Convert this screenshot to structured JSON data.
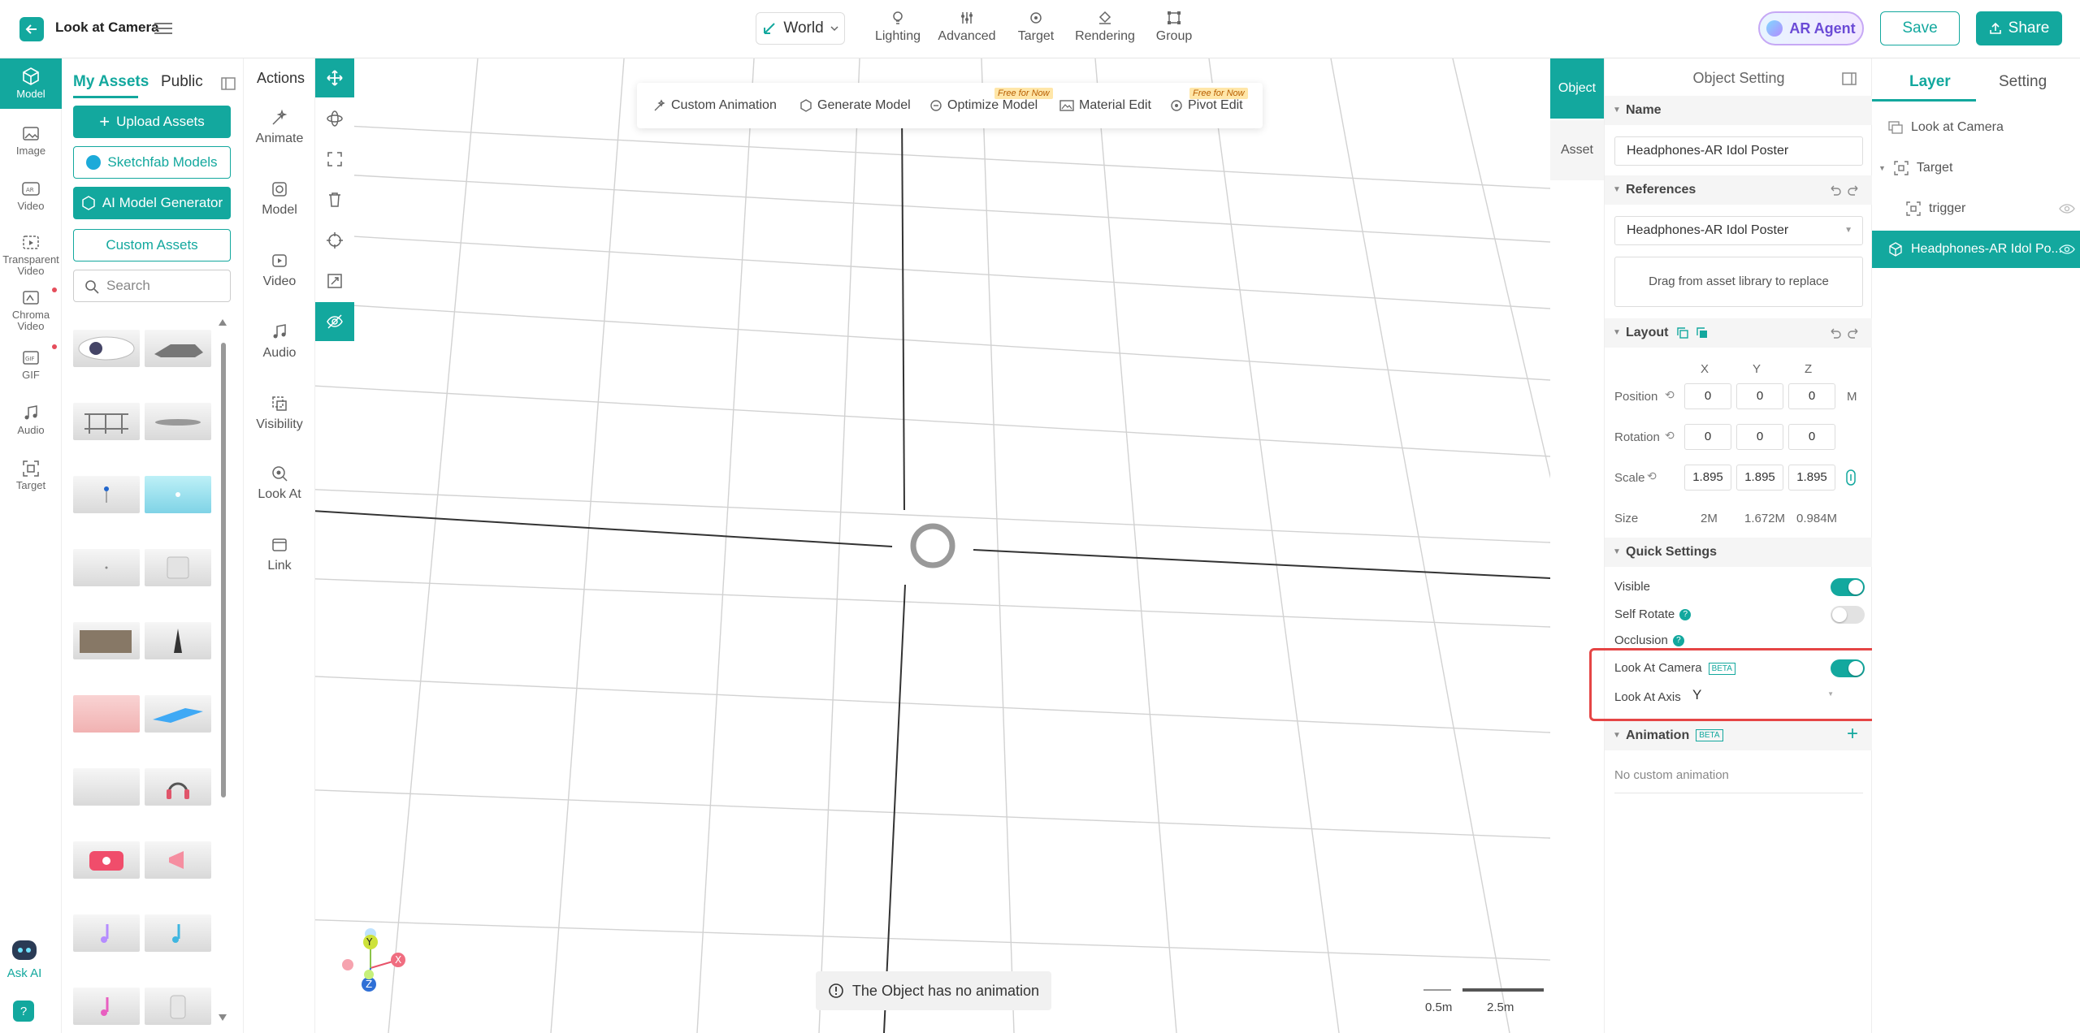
{
  "header": {
    "title": "Look at Camera",
    "world_label": "World",
    "tools": [
      {
        "label": "Lighting",
        "icon": "lightbulb-icon"
      },
      {
        "label": "Advanced",
        "icon": "sliders-icon"
      },
      {
        "label": "Target",
        "icon": "gear-target-icon"
      },
      {
        "label": "Rendering",
        "icon": "paint-bucket-icon"
      },
      {
        "label": "Group",
        "icon": "group-frame-icon"
      }
    ],
    "ar_agent_label": "AR Agent",
    "save_label": "Save",
    "share_label": "Share"
  },
  "rail": {
    "items": [
      {
        "label": "Model",
        "icon": "cube-icon"
      },
      {
        "label": "Image",
        "icon": "image-icon"
      },
      {
        "label": "Video",
        "icon": "ar-video-icon"
      },
      {
        "label": "Transparent Video",
        "icon": "transparent-video-icon"
      },
      {
        "label": "Chroma Video",
        "icon": "chroma-video-icon"
      },
      {
        "label": "GIF",
        "icon": "gif-icon"
      },
      {
        "label": "Audio",
        "icon": "music-note-icon"
      },
      {
        "label": "Target",
        "icon": "target-icon"
      }
    ],
    "ask_ai_label": "Ask AI"
  },
  "assets": {
    "tabs": [
      "My Assets",
      "Public"
    ],
    "upload_label": "Upload Assets",
    "sketchfab_label": "Sketchfab Models",
    "ai_generator_label": "AI Model Generator",
    "custom_label": "Custom Assets",
    "search_placeholder": "Search"
  },
  "actions": {
    "title": "Actions",
    "items": [
      {
        "label": "Animate",
        "icon": "wand-icon"
      },
      {
        "label": "Model",
        "icon": "model-icon"
      },
      {
        "label": "Video",
        "icon": "video-play-icon"
      },
      {
        "label": "Audio",
        "icon": "music-icon"
      },
      {
        "label": "Visibility",
        "icon": "visibility-icon"
      },
      {
        "label": "Look At",
        "icon": "look-at-icon"
      },
      {
        "label": "Link",
        "icon": "link-icon"
      }
    ]
  },
  "viewport": {
    "float_toolbar": [
      {
        "label": "Custom Animation"
      },
      {
        "label": "Generate Model"
      },
      {
        "label": "Optimize Model",
        "tag": "Free for Now"
      },
      {
        "label": "Material Edit"
      },
      {
        "label": "Pivot Edit",
        "tag": "Free for Now"
      }
    ],
    "no_animation_msg": "The Object has no animation",
    "scale_left": "0.5m",
    "scale_right": "2.5m",
    "axes": {
      "x": "X",
      "y": "Y",
      "z": "Z"
    }
  },
  "side_tabs": {
    "object": "Object",
    "asset": "Asset"
  },
  "object_setting": {
    "title": "Object Setting",
    "name_section": "Name",
    "name_value": "Headphones-AR Idol Poster",
    "references_section": "References",
    "reference_value": "Headphones-AR Idol Poster",
    "drag_hint": "Drag from asset library to replace",
    "layout_section": "Layout",
    "axis_labels": [
      "X",
      "Y",
      "Z"
    ],
    "position_label": "Position",
    "position": [
      "0",
      "0",
      "0"
    ],
    "position_unit": "M",
    "rotation_label": "Rotation",
    "rotation": [
      "0",
      "0",
      "0"
    ],
    "scale_label": "Scale",
    "scale": [
      "1.895",
      "1.895",
      "1.895"
    ],
    "size_label": "Size",
    "size": [
      "2M",
      "1.672M",
      "0.984M"
    ],
    "quick_section": "Quick Settings",
    "visible_label": "Visible",
    "visible_on": true,
    "self_rotate_label": "Self Rotate",
    "self_rotate_on": false,
    "occlusion_label": "Occlusion",
    "look_at_camera_label": "Look At Camera",
    "look_at_camera_on": true,
    "beta_tag": "BETA",
    "look_at_axis_label": "Look At Axis",
    "look_at_axis_value": "Y",
    "animation_section": "Animation",
    "no_custom_animation": "No custom animation",
    "accent_color": "#13a89e"
  },
  "layer_panel": {
    "tabs": [
      "Layer",
      "Setting"
    ],
    "rows": [
      {
        "label": "Look at Camera"
      },
      {
        "label": "Target"
      },
      {
        "label": "trigger"
      },
      {
        "label": "Headphones-AR Idol Po..."
      }
    ]
  }
}
